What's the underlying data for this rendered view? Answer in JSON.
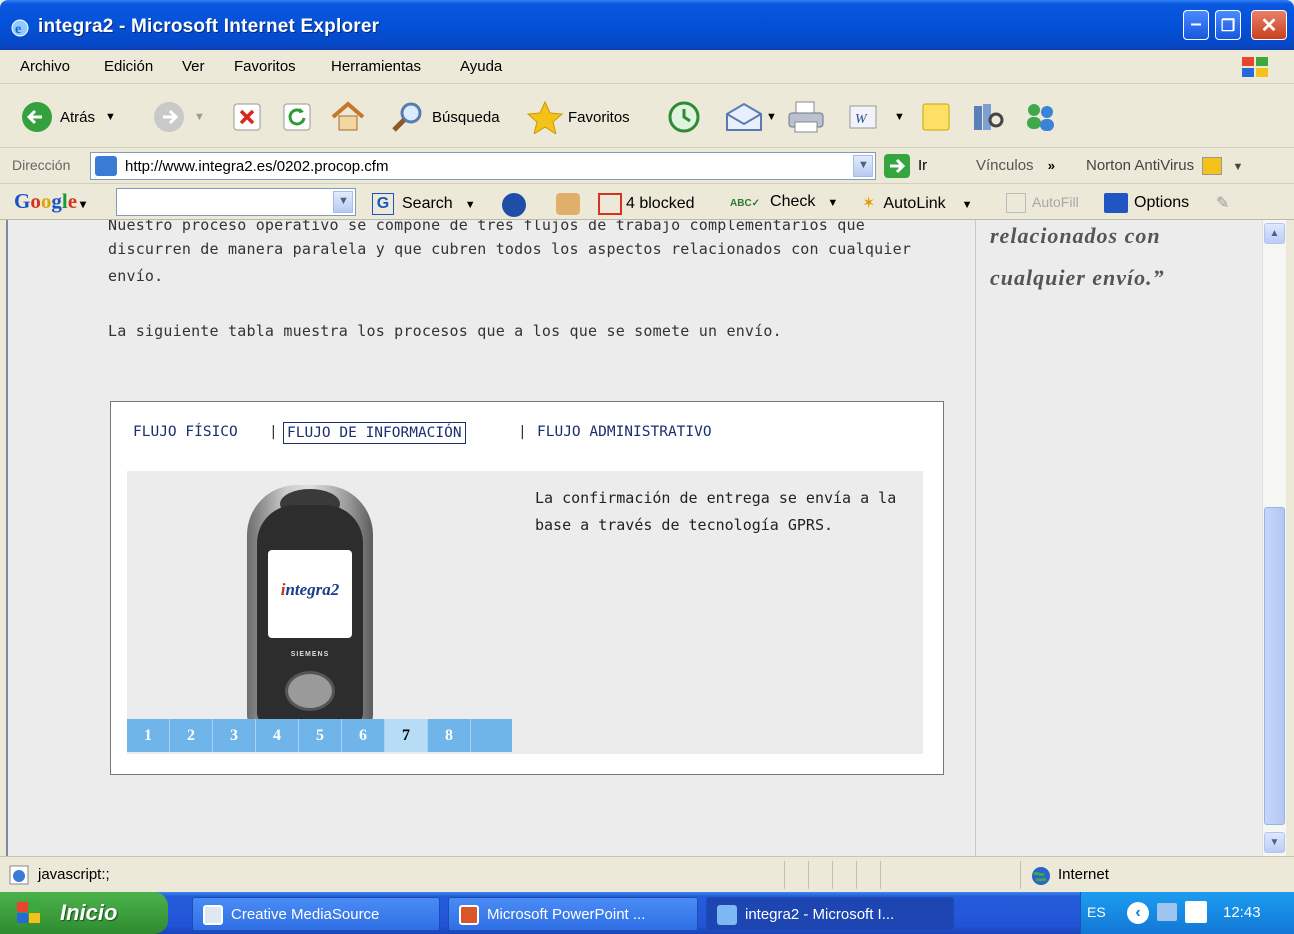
{
  "window": {
    "title": "integra2 - Microsoft Internet Explorer"
  },
  "menu": [
    "Archivo",
    "Edición",
    "Ver",
    "Favoritos",
    "Herramientas",
    "Ayuda"
  ],
  "toolbar": {
    "back": "Atrás",
    "search": "Búsqueda",
    "favorites": "Favoritos"
  },
  "address": {
    "label": "Dirección",
    "url": "http://www.integra2.es/0202.procop.cfm",
    "go": "Ir",
    "links": "Vínculos",
    "norton": "Norton AntiVirus"
  },
  "googlebar": {
    "search": "Search",
    "blocked": "4 blocked",
    "check": "Check",
    "autolink": "AutoLink",
    "autofill": "AutoFill",
    "options": "Options"
  },
  "page": {
    "intro_line1": "Nuestro proceso operativo se compone de tres flujos de trabajo complementarios que",
    "intro_line2": "discurren de manera paralela y que cubren todos los aspectos relacionados con cualquier",
    "intro_line3": "envío.",
    "table_intro": "La siguiente tabla muestra los procesos que a los que se somete un envío.",
    "quote_line1": "relacionados con",
    "quote_line2": "cualquier envío.”",
    "tabs": {
      "physical": "FLUJO FÍSICO",
      "information": "FLUJO DE INFORMACIÓN",
      "administrative": "FLUJO ADMINISTRATIVO",
      "sep": "|"
    },
    "panel_text": "La confirmación de entrega se envía a la base a través de tecnología GPRS.",
    "phone_logo_i": "i",
    "phone_logo_rest": "ntegra2",
    "phone_brand": "SIEMENS",
    "steps": [
      "1",
      "2",
      "3",
      "4",
      "5",
      "6",
      "7",
      "8"
    ],
    "active_step": "7"
  },
  "status": {
    "text": "javascript:;",
    "zone": "Internet"
  },
  "taskbar": {
    "start": "Inicio",
    "items": [
      "Creative MediaSource",
      "Microsoft PowerPoint ...",
      "integra2 - Microsoft I..."
    ],
    "lang": "ES",
    "clock": "12:43"
  },
  "colors": {
    "accent": "#0451d8",
    "tab_text": "#1b2e6e",
    "step_bar": "#6fb5ea"
  }
}
